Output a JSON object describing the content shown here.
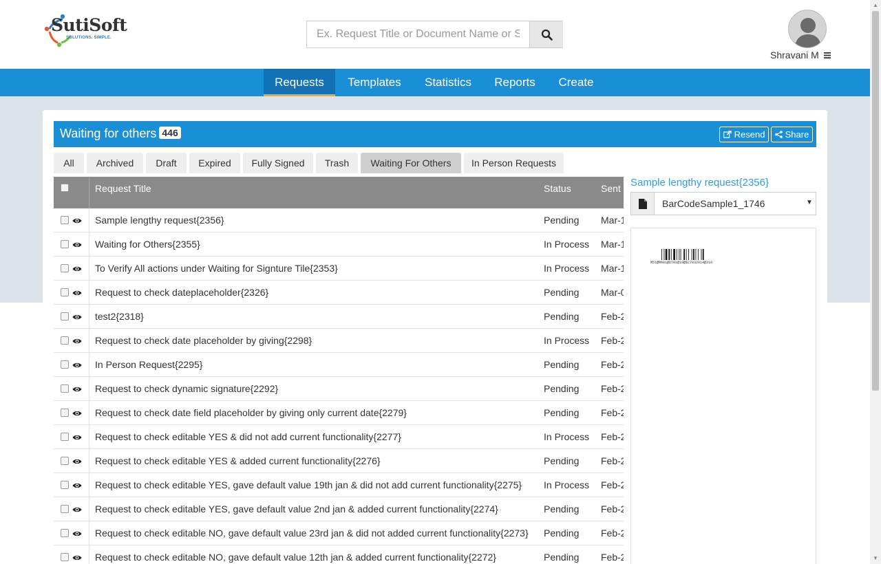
{
  "logo": {
    "name": "SutiSoft",
    "tagline": "SOLUTIONS. SIMPLE."
  },
  "search": {
    "placeholder": "Ex. Request Title or Document Name or S"
  },
  "user": {
    "name": "Shravani M"
  },
  "nav": [
    {
      "label": "Requests",
      "active": true
    },
    {
      "label": "Templates",
      "active": false
    },
    {
      "label": "Statistics",
      "active": false
    },
    {
      "label": "Reports",
      "active": false
    },
    {
      "label": "Create",
      "active": false
    }
  ],
  "panel": {
    "title": "Waiting for others",
    "count": "446",
    "resend_label": "Resend",
    "share_label": "Share"
  },
  "tabs": [
    {
      "label": "All",
      "active": false
    },
    {
      "label": "Archived",
      "active": false
    },
    {
      "label": "Draft",
      "active": false
    },
    {
      "label": "Expired",
      "active": false
    },
    {
      "label": "Fully Signed",
      "active": false
    },
    {
      "label": "Trash",
      "active": false
    },
    {
      "label": "Waiting For Others",
      "active": true
    },
    {
      "label": "In Person Requests",
      "active": false
    }
  ],
  "table": {
    "columns": {
      "title": "Request Title",
      "status": "Status",
      "sent": "Sent"
    },
    "rows": [
      {
        "title": "Sample lengthy request{2356}",
        "status": "Pending",
        "sent": "Mar-1"
      },
      {
        "title": "Waiting for Others{2355}",
        "status": "In Process",
        "sent": "Mar-1"
      },
      {
        "title": "To Verify All actions under Waiting for Signture Tile{2353}",
        "status": "In Process",
        "sent": "Mar-1"
      },
      {
        "title": "Request to check dateplaceholder{2326}",
        "status": "Pending",
        "sent": "Mar-0"
      },
      {
        "title": "test2{2318}",
        "status": "Pending",
        "sent": "Feb-2"
      },
      {
        "title": "Request to check date placeholder by giving{2298}",
        "status": "In Process",
        "sent": "Feb-2"
      },
      {
        "title": "In Person Request{2295}",
        "status": "Pending",
        "sent": "Feb-2"
      },
      {
        "title": "Request to check dynamic signature{2292}",
        "status": "Pending",
        "sent": "Feb-2"
      },
      {
        "title": "Request to check date field placeholder by giving only current date{2279}",
        "status": "Pending",
        "sent": "Feb-2"
      },
      {
        "title": "Request to check editable YES & did not add current functionality{2277}",
        "status": "In Process",
        "sent": "Feb-2"
      },
      {
        "title": "Request to check editable YES & added current functionality{2276}",
        "status": "Pending",
        "sent": "Feb-2"
      },
      {
        "title": "Request to check editable YES, gave default value 19th jan & did not add current functionality{2275}",
        "status": "In Process",
        "sent": "Feb-2"
      },
      {
        "title": "Request to check editable YES, gave default value 2nd jan & added current functionality{2274}",
        "status": "Pending",
        "sent": "Feb-2"
      },
      {
        "title": "Request to check editable NO, gave default value 23rd jan & did not added current functionality{2273}",
        "status": "Pending",
        "sent": "Feb-2"
      },
      {
        "title": "Request to check editable NO, gave default value 12th jan & added current functionality{2272}",
        "status": "Pending",
        "sent": "Feb-2"
      }
    ]
  },
  "preview": {
    "title": "Sample lengthy request{2356}",
    "document": "BarCodeSample1_1746",
    "barcode_text": "M5t@MA01@DT01@10@$27032014@310"
  },
  "colors": {
    "brand_blue": "#1a8fd6",
    "nav_active": "#1272b5",
    "active_underline": "#f5a623",
    "link_blue": "#2a9ee0",
    "table_header": "#8a8a8a"
  }
}
